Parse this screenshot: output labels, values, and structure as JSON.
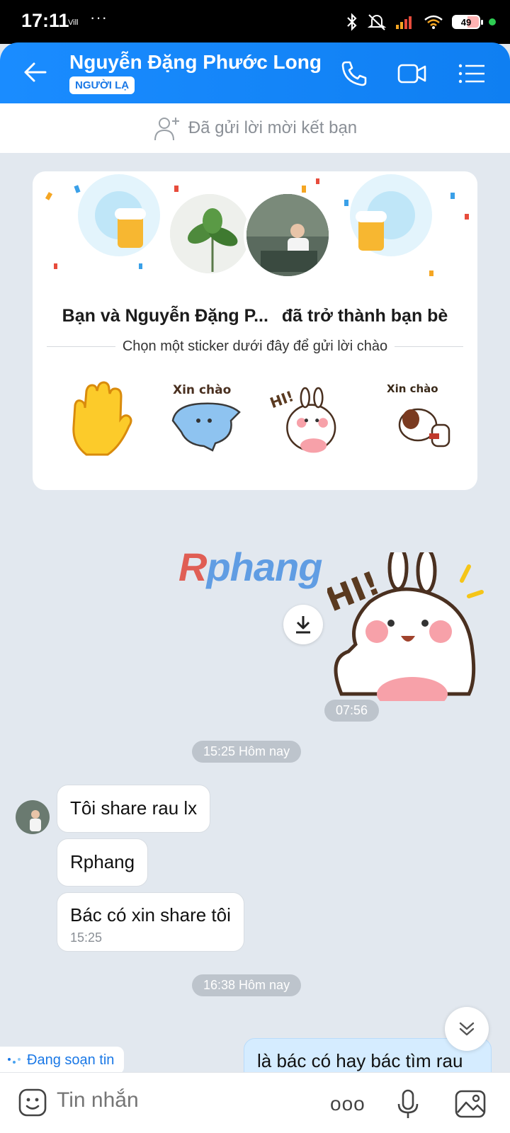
{
  "status_bar": {
    "time": "17:11",
    "network": "Vill",
    "dots": "···",
    "battery": "49"
  },
  "header": {
    "contact_name": "Nguyễn Đặng Phước Long",
    "tag": "NGƯỜI LẠ",
    "back_icon": "arrow-left-icon",
    "call_icon": "phone-icon",
    "video_icon": "video-camera-icon",
    "menu_icon": "list-menu-icon"
  },
  "friend_request": {
    "text": "Đã gửi lời mời kết bạn"
  },
  "friend_card": {
    "title_name": "Bạn và Nguyễn Đặng P...",
    "title_rest": "đã trở thành bạn bè",
    "subtitle": "Chọn một sticker dưới đây để gửi lời chào",
    "stickers": [
      {
        "name": "waving-hand",
        "caption": ""
      },
      {
        "name": "xin-chao-blue-cat",
        "caption": "Xin chào"
      },
      {
        "name": "hi-bunny",
        "caption": "HI!"
      },
      {
        "name": "xin-chao-dog",
        "caption": "Xin chào"
      }
    ]
  },
  "watermark": {
    "r": "R",
    "rest": "phang"
  },
  "sent_sticker": {
    "caption": "HI!",
    "time": "07:56"
  },
  "separators": {
    "first": "15:25 Hôm nay",
    "second": "16:38 Hôm nay"
  },
  "messages": [
    {
      "text": "Tôi share rau lx"
    },
    {
      "text": "Rphang"
    },
    {
      "text": "Bác có xin share tôi",
      "time": "15:25"
    }
  ],
  "typing_indicator": "Đang soạn tin",
  "outgoing_message": "là bác có hay bác tìm rau",
  "input": {
    "placeholder": "Tin nhắn",
    "more_dots": "ooo"
  },
  "colors": {
    "header_blue": "#1a8cff",
    "chat_bg": "#e2e8ef",
    "outgoing_bubble": "#d5ecff"
  }
}
